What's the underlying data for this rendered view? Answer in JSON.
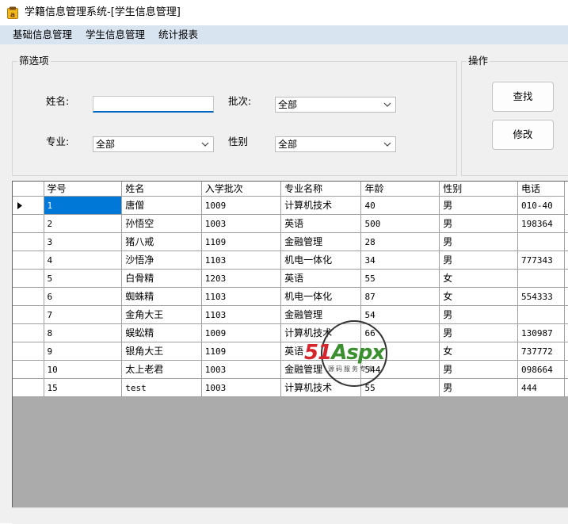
{
  "window": {
    "title": "学籍信息管理系统-[学生信息管理]"
  },
  "menu": {
    "items": [
      "基础信息管理",
      "学生信息管理",
      "统计报表"
    ]
  },
  "filter": {
    "title": "筛选项",
    "name_label": "姓名:",
    "name_value": "",
    "batch_label": "批次:",
    "batch_value": "全部",
    "major_label": "专业:",
    "major_value": "全部",
    "gender_label": "性别",
    "gender_value": "全部"
  },
  "actions": {
    "title": "操作",
    "search_label": "查找",
    "edit_label": "修改"
  },
  "grid": {
    "columns": [
      "学号",
      "姓名",
      "入学批次",
      "专业名称",
      "年龄",
      "性别",
      "电话"
    ],
    "rows": [
      [
        "1",
        "唐僧",
        "1009",
        "计算机技术",
        "40",
        "男",
        "010-40"
      ],
      [
        "2",
        "孙悟空",
        "1003",
        "英语",
        "500",
        "男",
        "198364"
      ],
      [
        "3",
        "猪八戒",
        "1109",
        "金融管理",
        "28",
        "男",
        ""
      ],
      [
        "4",
        "沙悟净",
        "1103",
        "机电一体化",
        "34",
        "男",
        "777343"
      ],
      [
        "5",
        "白骨精",
        "1203",
        "英语",
        "55",
        "女",
        ""
      ],
      [
        "6",
        "蜘蛛精",
        "1103",
        "机电一体化",
        "87",
        "女",
        "554333"
      ],
      [
        "7",
        "金角大王",
        "1103",
        "金融管理",
        "54",
        "男",
        ""
      ],
      [
        "8",
        "蜈蚣精",
        "1009",
        "计算机技术",
        "66",
        "男",
        "130987"
      ],
      [
        "9",
        "银角大王",
        "1109",
        "英语",
        "",
        "女",
        "737772"
      ],
      [
        "10",
        "太上老君",
        "1003",
        "金融管理",
        "544",
        "男",
        "098664"
      ],
      [
        "15",
        "test",
        "1003",
        "计算机技术",
        "55",
        "男",
        "444"
      ]
    ]
  },
  "watermark": {
    "brand_a": "51",
    "brand_b": "Aspx",
    "tagline": "源码服务专家"
  },
  "colors": {
    "selection": "#0078d7",
    "menubar": "#d9e4f1",
    "brand_red": "#d6262b",
    "brand_green": "#3a8f2e"
  }
}
